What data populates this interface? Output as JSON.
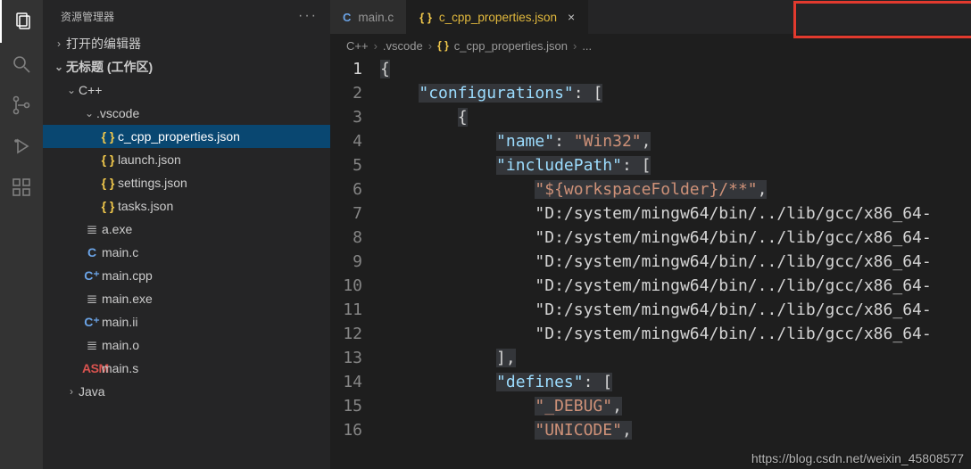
{
  "activity": {
    "icons": [
      "files",
      "search",
      "source-control",
      "debug",
      "extensions"
    ]
  },
  "sidebar": {
    "title": "资源管理器",
    "sections": {
      "open_editors": "打开的编辑器",
      "workspace": "无标题 (工作区)"
    },
    "tree": [
      {
        "label": "C++",
        "type": "folder"
      },
      {
        "label": ".vscode",
        "type": "folder"
      },
      {
        "label": "c_cpp_properties.json",
        "type": "json",
        "selected": true
      },
      {
        "label": "launch.json",
        "type": "json"
      },
      {
        "label": "settings.json",
        "type": "json"
      },
      {
        "label": "tasks.json",
        "type": "json"
      },
      {
        "label": "a.exe",
        "type": "lines"
      },
      {
        "label": "main.c",
        "type": "c"
      },
      {
        "label": "main.cpp",
        "type": "cpp"
      },
      {
        "label": "main.exe",
        "type": "lines"
      },
      {
        "label": "main.ii",
        "type": "cpp"
      },
      {
        "label": "main.o",
        "type": "lines"
      },
      {
        "label": "main.s",
        "type": "asm"
      },
      {
        "label": "Java",
        "type": "folder"
      }
    ]
  },
  "tabs": [
    {
      "label": "main.c",
      "icon": "C",
      "iconcolor": "#6ba4e7",
      "active": false
    },
    {
      "label": "c_cpp_properties.json",
      "icon": "{ }",
      "iconcolor": "#f2c94c",
      "active": true
    }
  ],
  "breadcrumb": {
    "parts": [
      "C++",
      ".vscode",
      "c_cpp_properties.json",
      "..."
    ],
    "icon_label": "{ }"
  },
  "code": {
    "lines": [
      "{",
      "    \"configurations\": [",
      "        {",
      "            \"name\": \"Win32\",",
      "            \"includePath\": [",
      "                \"${workspaceFolder}/**\",",
      "                \"D:/system/mingw64/bin/../lib/gcc/x86_64-",
      "                \"D:/system/mingw64/bin/../lib/gcc/x86_64-",
      "                \"D:/system/mingw64/bin/../lib/gcc/x86_64-",
      "                \"D:/system/mingw64/bin/../lib/gcc/x86_64-",
      "                \"D:/system/mingw64/bin/../lib/gcc/x86_64-",
      "                \"D:/system/mingw64/bin/../lib/gcc/x86_64-",
      "            ],",
      "            \"defines\": [",
      "                \"_DEBUG\",",
      "                \"UNICODE\","
    ],
    "total_lines": 16
  },
  "watermark": "https://blog.csdn.net/weixin_45808577"
}
